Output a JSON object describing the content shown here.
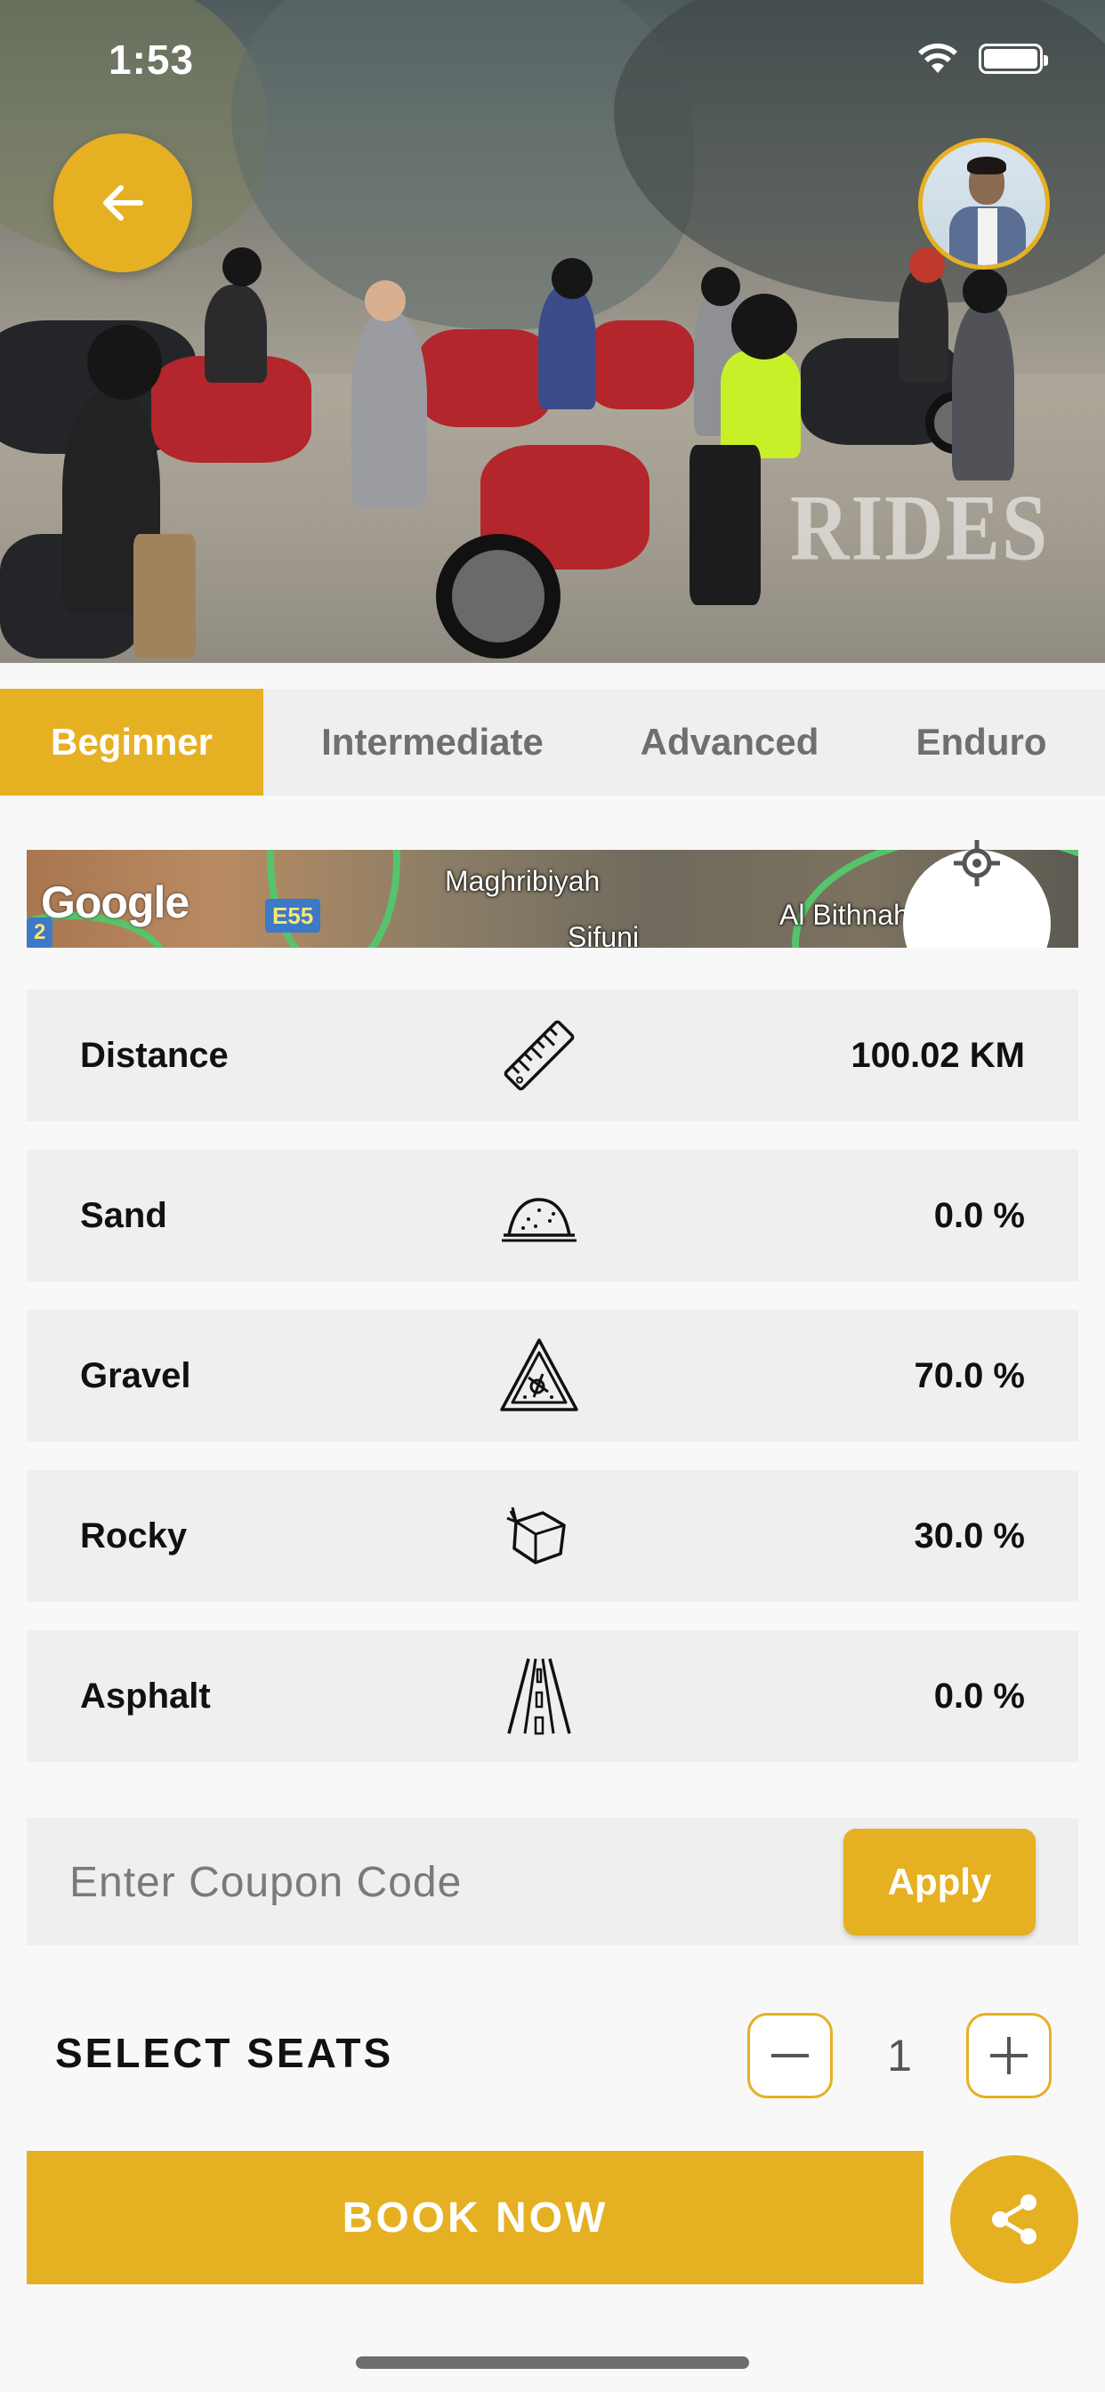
{
  "status_bar": {
    "time": "1:53"
  },
  "hero": {
    "watermark": "RIDES",
    "back_icon": "arrow-left-icon",
    "avatar_icon": "user-avatar"
  },
  "tabs": [
    {
      "label": "Beginner",
      "active": true
    },
    {
      "label": "Intermediate",
      "active": false
    },
    {
      "label": "Advanced",
      "active": false
    },
    {
      "label": "Enduro",
      "active": false
    }
  ],
  "map": {
    "logo": "Google",
    "road_badge": "E55",
    "badge_left": "2",
    "places": [
      "Maghribiyah",
      "Al Bithnah",
      "Sifuni"
    ],
    "locate_icon": "location-target-icon"
  },
  "stats": [
    {
      "label": "Distance",
      "icon": "ruler-icon",
      "value": "100.02 KM"
    },
    {
      "label": "Sand",
      "icon": "sand-pile-icon",
      "value": "0.0 %"
    },
    {
      "label": "Gravel",
      "icon": "gravel-warning-icon",
      "value": "70.0 %"
    },
    {
      "label": "Rocky",
      "icon": "rock-icon",
      "value": "30.0 %"
    },
    {
      "label": "Asphalt",
      "icon": "road-icon",
      "value": "0.0 %"
    }
  ],
  "coupon": {
    "placeholder": "Enter Coupon Code",
    "value": "",
    "apply_label": "Apply"
  },
  "seats": {
    "label": "SELECT SEATS",
    "count": "1"
  },
  "book": {
    "label": "BOOK NOW",
    "share_icon": "share-icon"
  },
  "colors": {
    "accent": "#E6B023",
    "panel": "#EFEFEF",
    "background": "#F8F8F8"
  }
}
